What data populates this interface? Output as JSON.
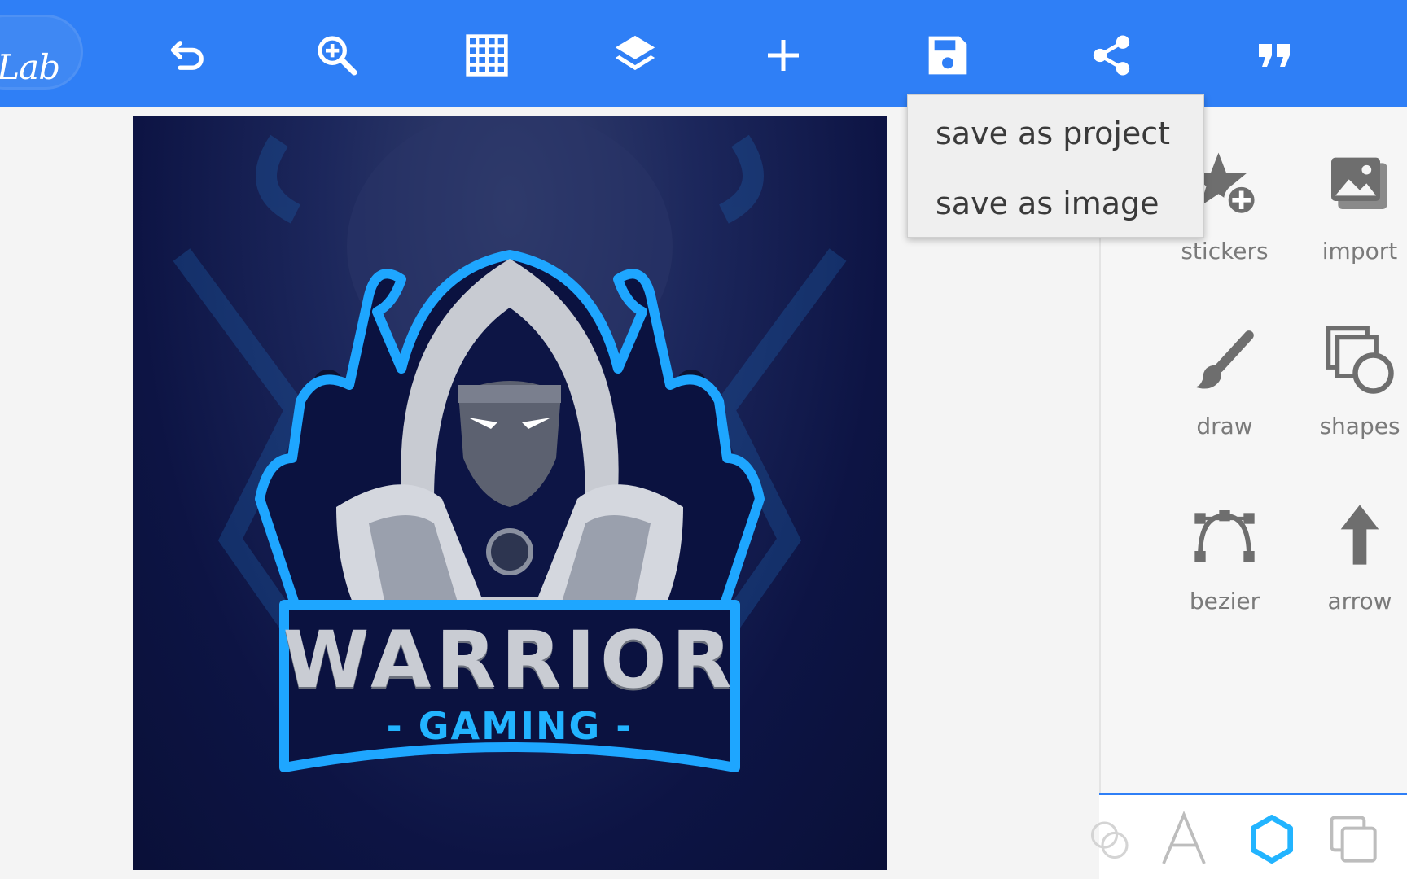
{
  "app": {
    "logo_text": "elLab"
  },
  "toolbar": {
    "buttons": [
      {
        "id": "undo",
        "icon": "undo-icon"
      },
      {
        "id": "zoom",
        "icon": "zoom-in-icon"
      },
      {
        "id": "grid",
        "icon": "grid-icon"
      },
      {
        "id": "layers",
        "icon": "layers-icon"
      },
      {
        "id": "add",
        "icon": "plus-icon"
      },
      {
        "id": "save",
        "icon": "save-icon"
      },
      {
        "id": "share",
        "icon": "share-icon"
      },
      {
        "id": "quote",
        "icon": "quote-icon"
      }
    ]
  },
  "save_menu": {
    "items": [
      {
        "label": "save as project"
      },
      {
        "label": "save as image"
      }
    ]
  },
  "tools": [
    {
      "label": "stickers",
      "icon": "sticker-add-icon"
    },
    {
      "label": "import",
      "icon": "image-import-icon"
    },
    {
      "label": "draw",
      "icon": "brush-icon"
    },
    {
      "label": "shapes",
      "icon": "shapes-icon"
    },
    {
      "label": "bezier",
      "icon": "bezier-icon"
    },
    {
      "label": "arrow",
      "icon": "arrow-up-icon"
    }
  ],
  "bottom_tabs": [
    {
      "icon": "circles-icon"
    },
    {
      "icon": "text-icon",
      "glyph": "A"
    },
    {
      "icon": "hexagon-icon",
      "active": true
    },
    {
      "icon": "copy-layers-icon"
    }
  ],
  "artwork": {
    "title": "WARRIOR",
    "subtitle": "- GAMING -"
  },
  "colors": {
    "toolbar": "#2f7ff6",
    "accent": "#22b4ff",
    "icon_gray": "#6e6e6e"
  }
}
